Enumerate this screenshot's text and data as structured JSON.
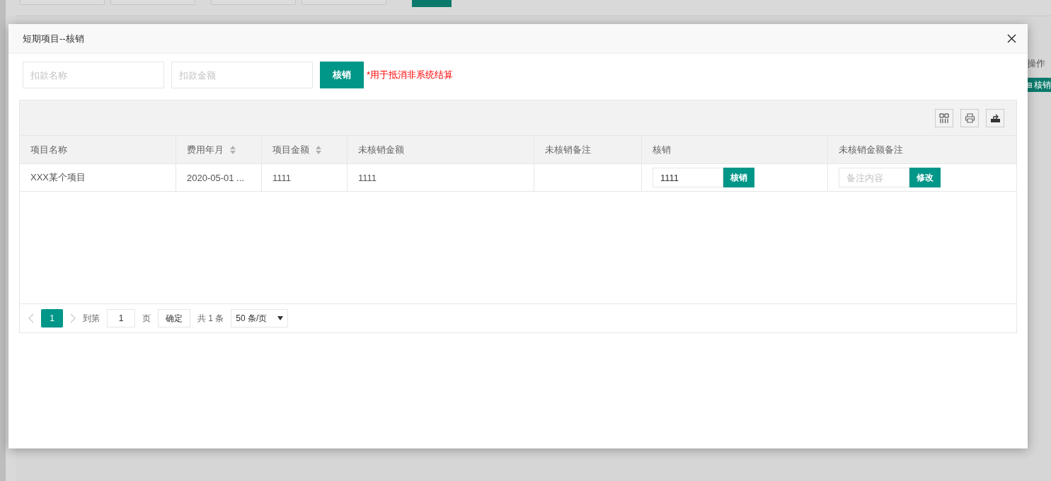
{
  "background": {
    "column_header": "操作",
    "row_button": "核销"
  },
  "dialog": {
    "title": "短期项目--核销",
    "form": {
      "fields": [
        {
          "placeholder": "扣款名称"
        },
        {
          "placeholder": "扣款金额"
        }
      ],
      "button": "核销",
      "note": "*用于抵消非系统结算"
    },
    "table": {
      "columns": [
        {
          "label": "项目名称",
          "sortable": false
        },
        {
          "label": "费用年月",
          "sortable": true
        },
        {
          "label": "项目金额",
          "sortable": true
        },
        {
          "label": "未核销金额",
          "sortable": false
        },
        {
          "label": "未核销备注",
          "sortable": false
        },
        {
          "label": "核销",
          "sortable": false
        },
        {
          "label": "未核销金额备注",
          "sortable": false
        }
      ],
      "rows": [
        {
          "name": "XXX某个项目",
          "month": "2020-05-01 ...",
          "amount": "1111",
          "unverified": "1111",
          "verify": {
            "value": "1111",
            "button": "核销"
          },
          "note": {
            "placeholder": "备注内容",
            "button": "修改"
          }
        }
      ]
    },
    "pagination": {
      "pages": [
        {
          "label": "1",
          "selected": true
        }
      ],
      "goto_label": "到第",
      "goto_value": "1",
      "page_unit": "页",
      "confirm": "确定",
      "total": "共 1 条",
      "page_size": "50 条/页"
    }
  }
}
